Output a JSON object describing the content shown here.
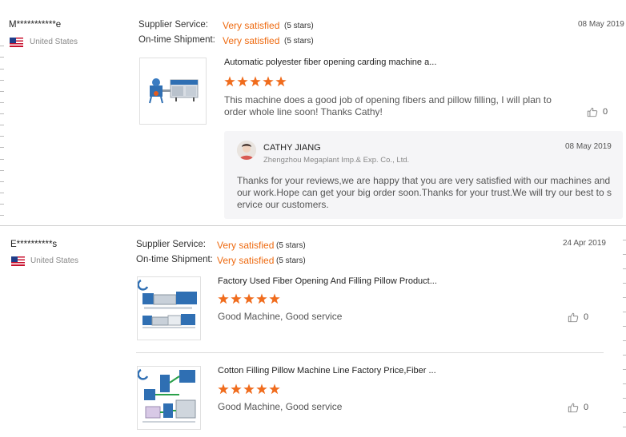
{
  "reviews": [
    {
      "reviewer": "M***********e",
      "country": "United States",
      "date": "08 May 2019",
      "supplier_label": "Supplier Service:",
      "supplier_value": "Very satisfied",
      "supplier_stars": "(5 stars)",
      "shipment_label": "On-time Shipment:",
      "shipment_value": "Very satisfied",
      "shipment_stars": "(5 stars)",
      "products": [
        {
          "title": "Automatic polyester fiber opening carding machine a...",
          "rating": 5,
          "comment": "This machine does a good job of opening fibers and pillow filling, I will plan to order whole line soon! Thanks Cathy!",
          "likes": "0"
        }
      ],
      "reply": {
        "name": "CATHY JIANG",
        "company": "Zhengzhou Megaplant Imp.& Exp. Co., Ltd.",
        "date": "08 May 2019",
        "text": "Thanks for your reviews,we are happy that you are very satisfied with our machines and our work.Hope can get your big order soon.Thanks for your trust.We will try our best to service our customers."
      }
    },
    {
      "reviewer": "E**********s",
      "country": "United States",
      "date": "24 Apr 2019",
      "supplier_label": "Supplier Service:",
      "supplier_value": "Very satisfied",
      "supplier_stars": "(5 stars)",
      "shipment_label": "On-time Shipment:",
      "shipment_value": "Very satisfied",
      "shipment_stars": "(5 stars)",
      "products": [
        {
          "title": "Factory Used Fiber Opening And Filling Pillow Product...",
          "rating": 5,
          "comment": "Good Machine, Good service",
          "likes": "0"
        },
        {
          "title": "Cotton Filling Pillow Machine Line Factory Price,Fiber ...",
          "rating": 5,
          "comment": "Good Machine, Good service",
          "likes": "0"
        }
      ]
    }
  ],
  "icons": {
    "flag": "us-flag-icon",
    "star": "star-icon",
    "like": "thumbs-up-icon",
    "avatar": "avatar"
  },
  "colors": {
    "accent": "#ee6a10",
    "star": "#f06c1d",
    "reply_bg": "#f5f5f7"
  }
}
